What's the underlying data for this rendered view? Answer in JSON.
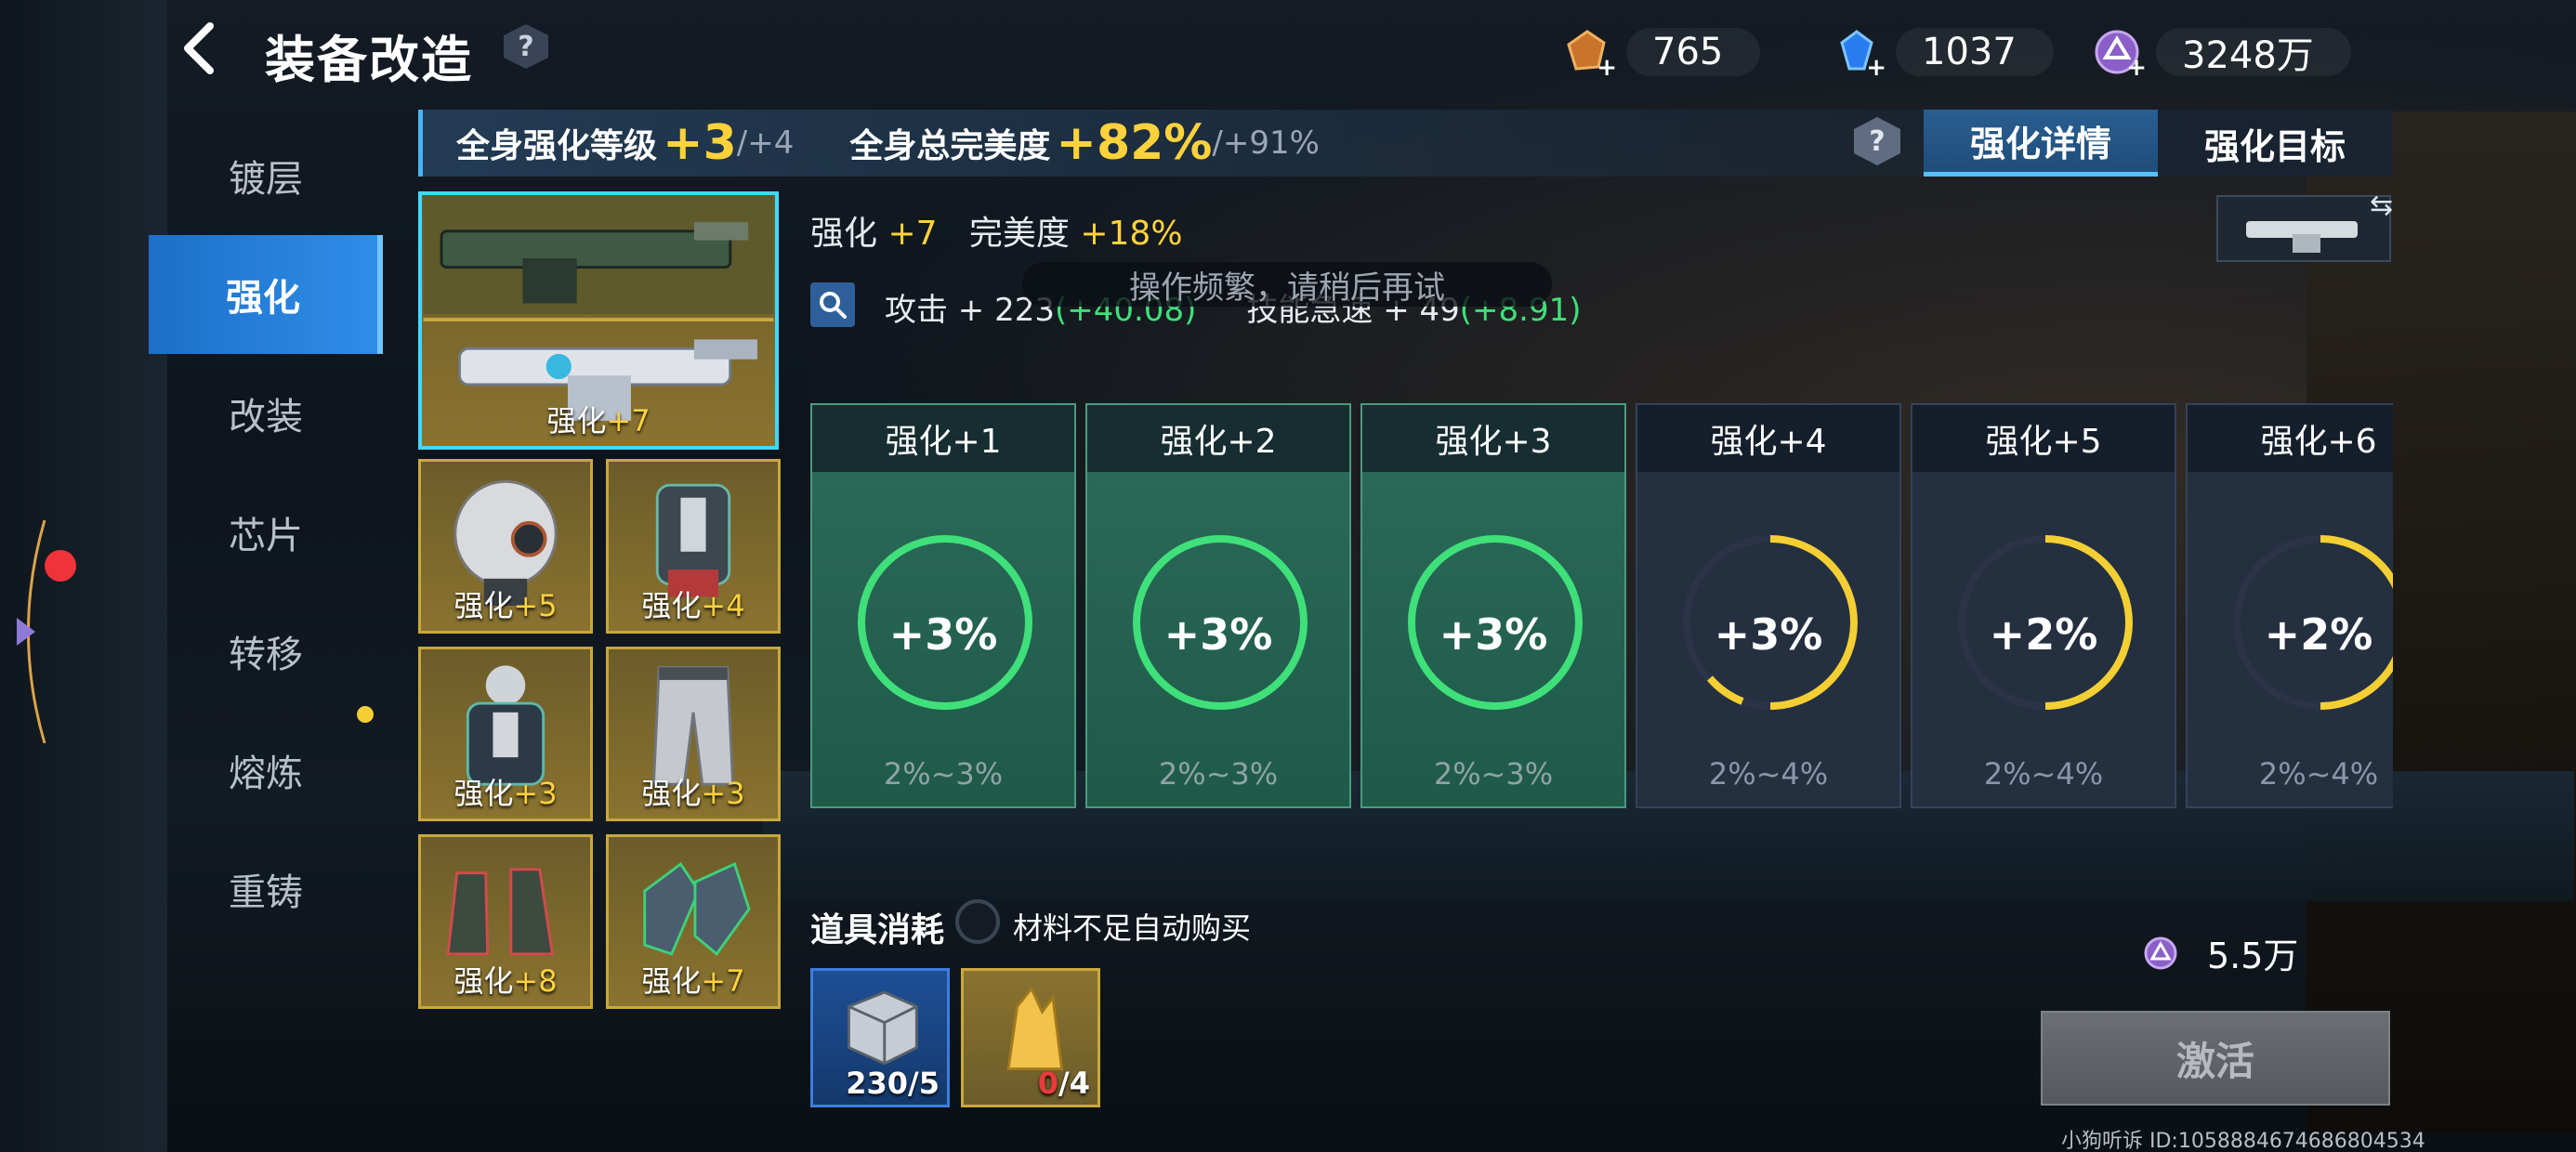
{
  "header": {
    "title": "装备改造",
    "help": "?",
    "currencies": [
      {
        "name": "fragment-currency",
        "value": "765"
      },
      {
        "name": "diamond-currency",
        "value": "1037"
      },
      {
        "name": "coin-currency",
        "value": "3248万"
      }
    ]
  },
  "nav": {
    "items": [
      {
        "label": "镀层"
      },
      {
        "label": "强化"
      },
      {
        "label": "改装"
      },
      {
        "label": "芯片"
      },
      {
        "label": "转移"
      },
      {
        "label": "熔炼"
      },
      {
        "label": "重铸"
      }
    ],
    "active_index": 1
  },
  "summary": {
    "level_label": "全身强化等级",
    "level_value": "+3",
    "level_max": "/+4",
    "perfect_label": "全身总完美度",
    "perfect_value": "+82%",
    "perfect_max": "/+91%",
    "help": "?"
  },
  "tabs": [
    {
      "label": "强化详情",
      "active": true
    },
    {
      "label": "强化目标",
      "active": false
    }
  ],
  "equipment": {
    "weapon_primary": {
      "label": "",
      "level": ""
    },
    "weapon_secondary": {
      "label": "强化",
      "level": "+7"
    },
    "helmet": {
      "label": "强化",
      "level": "+5"
    },
    "backpack": {
      "label": "强化",
      "level": "+4"
    },
    "armor": {
      "label": "强化",
      "level": "+3"
    },
    "pants": {
      "label": "强化",
      "level": "+3"
    },
    "boots": {
      "label": "强化",
      "level": "+8"
    },
    "gloves": {
      "label": "强化",
      "level": "+7"
    }
  },
  "details": {
    "enh_label": "强化",
    "enh_value": "+7",
    "perfect_label": "完美度",
    "perfect_value": "+18%",
    "attack_label": "攻击 + 223",
    "attack_bonus": "(+40.08)",
    "skill_label": "技能急速 + 49",
    "skill_bonus": "(+8.91)",
    "toast": "操作频繁，请稍后再试"
  },
  "levels": [
    {
      "title": "强化+1",
      "value": "+3%",
      "range": "2%~3%",
      "done": true
    },
    {
      "title": "强化+2",
      "value": "+3%",
      "range": "2%~3%",
      "done": true
    },
    {
      "title": "强化+3",
      "value": "+3%",
      "range": "2%~3%",
      "done": true
    },
    {
      "title": "强化+4",
      "value": "+3%",
      "range": "2%~4%",
      "done": false
    },
    {
      "title": "强化+5",
      "value": "+2%",
      "range": "2%~4%",
      "done": false
    },
    {
      "title": "强化+6",
      "value": "+2%",
      "range": "2%~4%",
      "done": false
    }
  ],
  "materials": {
    "title": "道具消耗",
    "auto_buy": "材料不足自动购买",
    "items": [
      {
        "name": "metal-cube",
        "have": "230",
        "need": "/5"
      },
      {
        "name": "gold-crystal",
        "have": "0",
        "need": "/4"
      }
    ],
    "cost": "5.5万",
    "activate": "激活"
  },
  "footer": {
    "id_text": "小狗听诉 ID:1058884674686804534"
  },
  "colors": {
    "accent_blue": "#2f8ee8",
    "gold": "#ffd23c",
    "green": "#3fe07a",
    "ring_done": "#3fe07a",
    "ring_todo": "#f3cf33"
  }
}
